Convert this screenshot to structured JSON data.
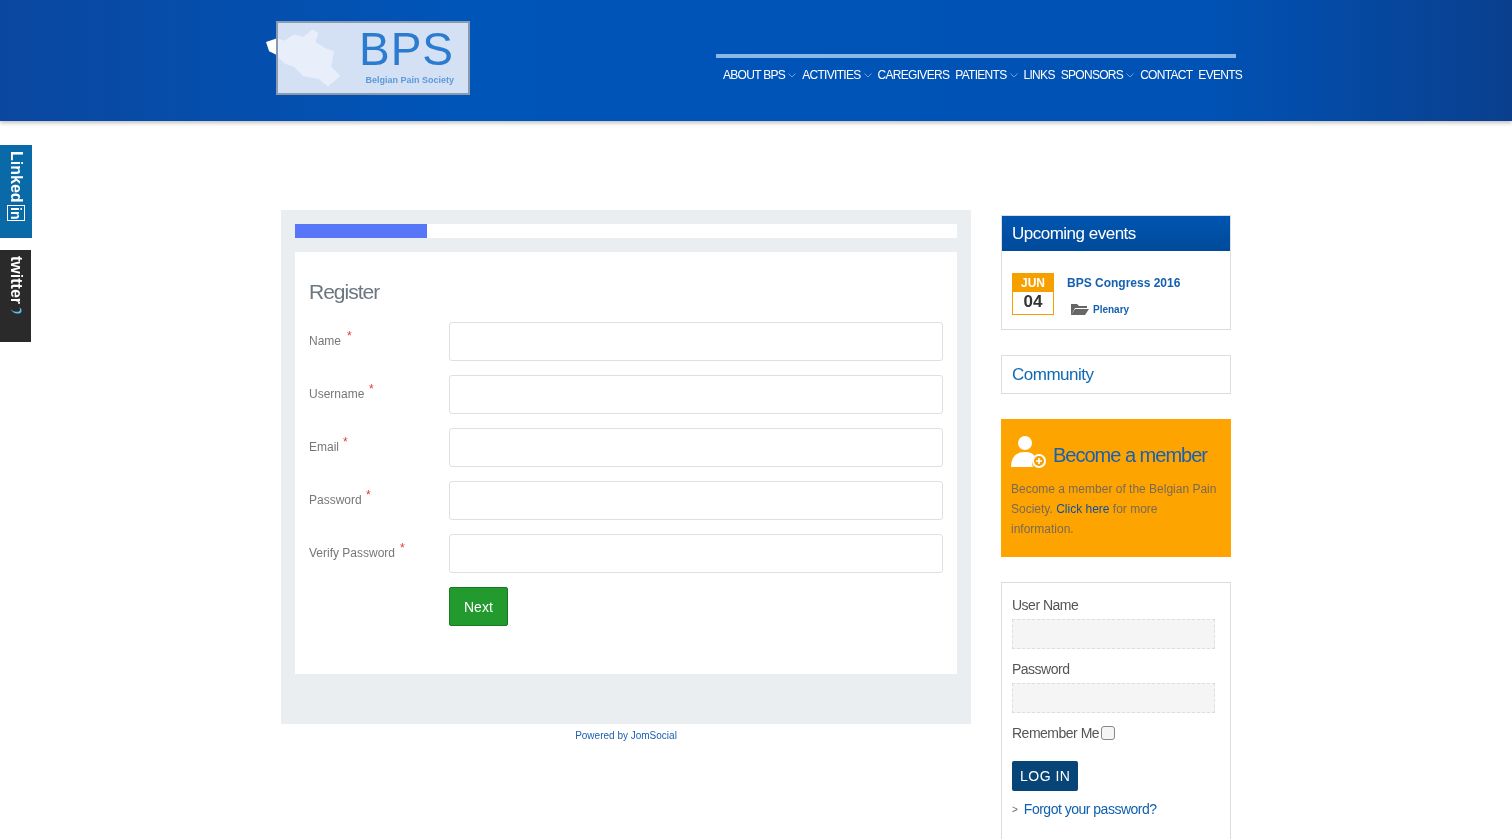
{
  "header": {
    "logo": {
      "letters": "BPS",
      "tagline": "Belgian Pain Society"
    },
    "nav": [
      {
        "label": "ABOUT BPS",
        "has_dropdown": true
      },
      {
        "label": "ACTIVITIES",
        "has_dropdown": true
      },
      {
        "label": "CAREGIVERS",
        "has_dropdown": false
      },
      {
        "label": "PATIENTS",
        "has_dropdown": true
      },
      {
        "label": "LINKS",
        "has_dropdown": false
      },
      {
        "label": "SPONSORS",
        "has_dropdown": true
      },
      {
        "label": "CONTACT",
        "has_dropdown": false
      },
      {
        "label": "EVENTS",
        "has_dropdown": false
      }
    ]
  },
  "social": {
    "linkedin": {
      "text": "Linked",
      "badge": "in"
    },
    "twitter": {
      "text": "twitter"
    }
  },
  "register": {
    "progress": {
      "level": 0.2
    },
    "title": "Register",
    "fields": [
      {
        "label": "Name",
        "required_mark": "*"
      },
      {
        "label": "Username",
        "required_mark": "*"
      },
      {
        "label": "Email",
        "required_mark": "*"
      },
      {
        "label": "Password",
        "required_mark": "*"
      },
      {
        "label": "Verify Password",
        "required_mark": "*"
      }
    ],
    "next_button": "Next",
    "powered_by": "Powered by JomSocial"
  },
  "sidebar": {
    "events": {
      "title": "Upcoming events",
      "items": [
        {
          "month": "JUN",
          "day": "04",
          "title": "BPS Congress 2016",
          "category": "Plenary"
        }
      ]
    },
    "community": {
      "title": "Community"
    },
    "member": {
      "title": "Become a member",
      "text_before": "Become a member of the Belgian Pain Society.",
      "link": "Click here",
      "text_after": "for more information."
    },
    "login": {
      "username_label": "User Name",
      "password_label": "Password",
      "remember_label": "Remember Me",
      "remember_checked": false,
      "button": "LOG IN",
      "forgot_link": "Forgot your password?",
      "forgot_marker": ">"
    }
  }
}
